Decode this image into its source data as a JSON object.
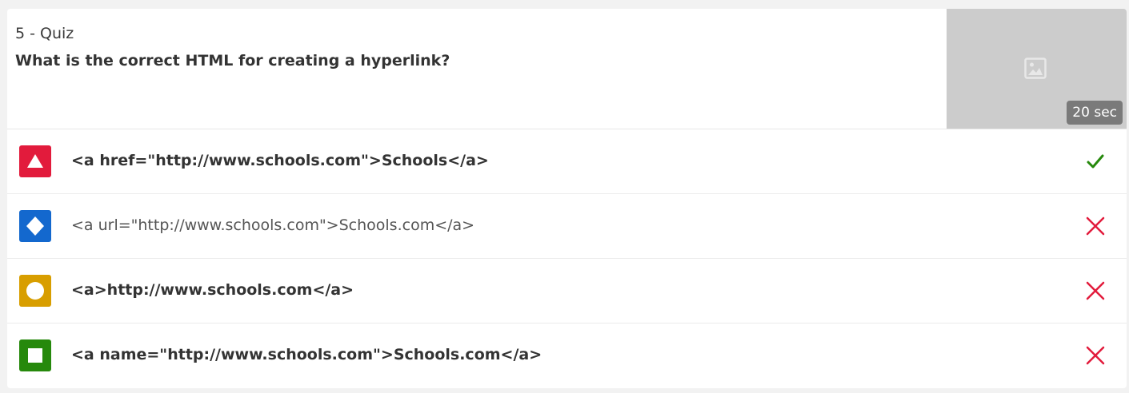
{
  "question": {
    "label": "5 - Quiz",
    "text": "What is the correct HTML for creating a hyperlink?",
    "time_limit": "20 sec"
  },
  "colors": {
    "red": "#e21b3c",
    "blue": "#1368ce",
    "yellow": "#d89e00",
    "green": "#26890c",
    "correct": "#26890c",
    "wrong": "#e21b3c"
  },
  "answers": [
    {
      "shape": "triangle-icon",
      "text": "<a href=\"http://www.schools.com\">Schools</a>",
      "correct": true
    },
    {
      "shape": "diamond-icon",
      "text": "<a url=\"http://www.schools.com\">Schools.com</a>",
      "correct": false
    },
    {
      "shape": "circle-icon",
      "text": "<a>http://www.schools.com</a>",
      "correct": false
    },
    {
      "shape": "square-icon",
      "text": "<a name=\"http://www.schools.com\">Schools.com</a>",
      "correct": false
    }
  ]
}
